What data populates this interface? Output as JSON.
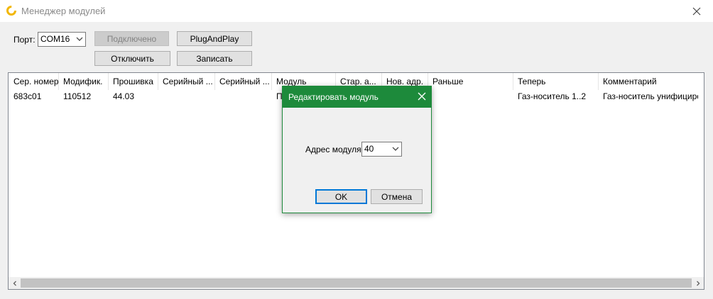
{
  "window": {
    "title": "Менеджер модулей"
  },
  "toolbar": {
    "port_label": "Порт:",
    "port_value": "COM16",
    "connected_label": "Подключено",
    "plugandplay_label": "PlugAndPlay",
    "disconnect_label": "Отключить",
    "write_label": "Записать"
  },
  "table": {
    "columns": [
      "Сер. номер",
      "Модифик.",
      "Прошивка",
      "Серийный ...",
      "Серийный ...",
      "Модуль",
      "Стар. а...",
      "Нов. адр.",
      "Раньше",
      "Теперь",
      "Комментарий"
    ],
    "rows": [
      [
        "683c01",
        "110512",
        "44.03",
        "",
        "",
        "П",
        "",
        "",
        "",
        "Газ-носитель 1..2",
        "Газ-носитель унифициро..."
      ]
    ]
  },
  "dialog": {
    "title": "Редактировать модуль",
    "address_label": "Адрес модуля:",
    "address_value": "40",
    "ok_label": "OK",
    "cancel_label": "Отмена"
  },
  "colors": {
    "dialog_accent": "#1d8a3b",
    "app_icon": "#f2b705"
  }
}
